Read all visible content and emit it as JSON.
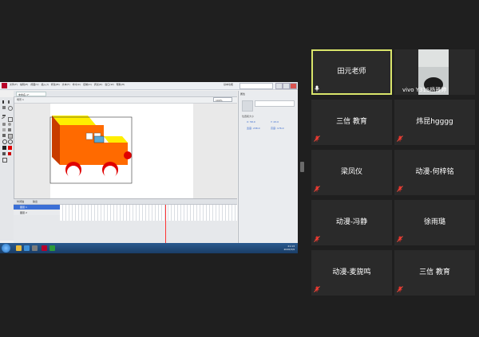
{
  "flash": {
    "menus": "文件(F) 编辑(E) 视图(V) 插入(I) 修改(M) 文本(T) 命令(C) 控制(O) 调试(D) 窗口(W) 帮助(H)",
    "workspace": "基本功能",
    "doc_tab": "未命名-1*",
    "scene": "场景 1",
    "zoom": "100%",
    "panel_tab": "属性",
    "panel_pos_label": "位置和大小",
    "panel_x": "X: 58.0",
    "panel_y": "Y: 43.0",
    "panel_w": "宽度: 238.0",
    "panel_h": "高度: 176.0",
    "timeline_tab": "时间轴",
    "output_tab": "输出",
    "layer_1": "图层 1",
    "layer_2": "图层 2",
    "clock_time": "21:13",
    "clock_date": "2020/3/9"
  },
  "participants": [
    {
      "name": "田元老师",
      "active": true
    },
    {
      "name": "vivo Y31S杨雅婷",
      "video": true
    },
    {
      "name": "三信 教育"
    },
    {
      "name": "炜昆hgggg"
    },
    {
      "name": "梁凤仪"
    },
    {
      "name": "动漫-何梓铭"
    },
    {
      "name": "动漫-冯静"
    },
    {
      "name": "徐雨璐"
    },
    {
      "name": "动漫-麦旎鸣"
    },
    {
      "name": "三信 教育"
    }
  ],
  "colors": {
    "active_border": "#d9e56b",
    "muted_mic": "#e0322b",
    "tile_bg": "#2a2a2a",
    "page_bg": "#1f1f1f"
  }
}
